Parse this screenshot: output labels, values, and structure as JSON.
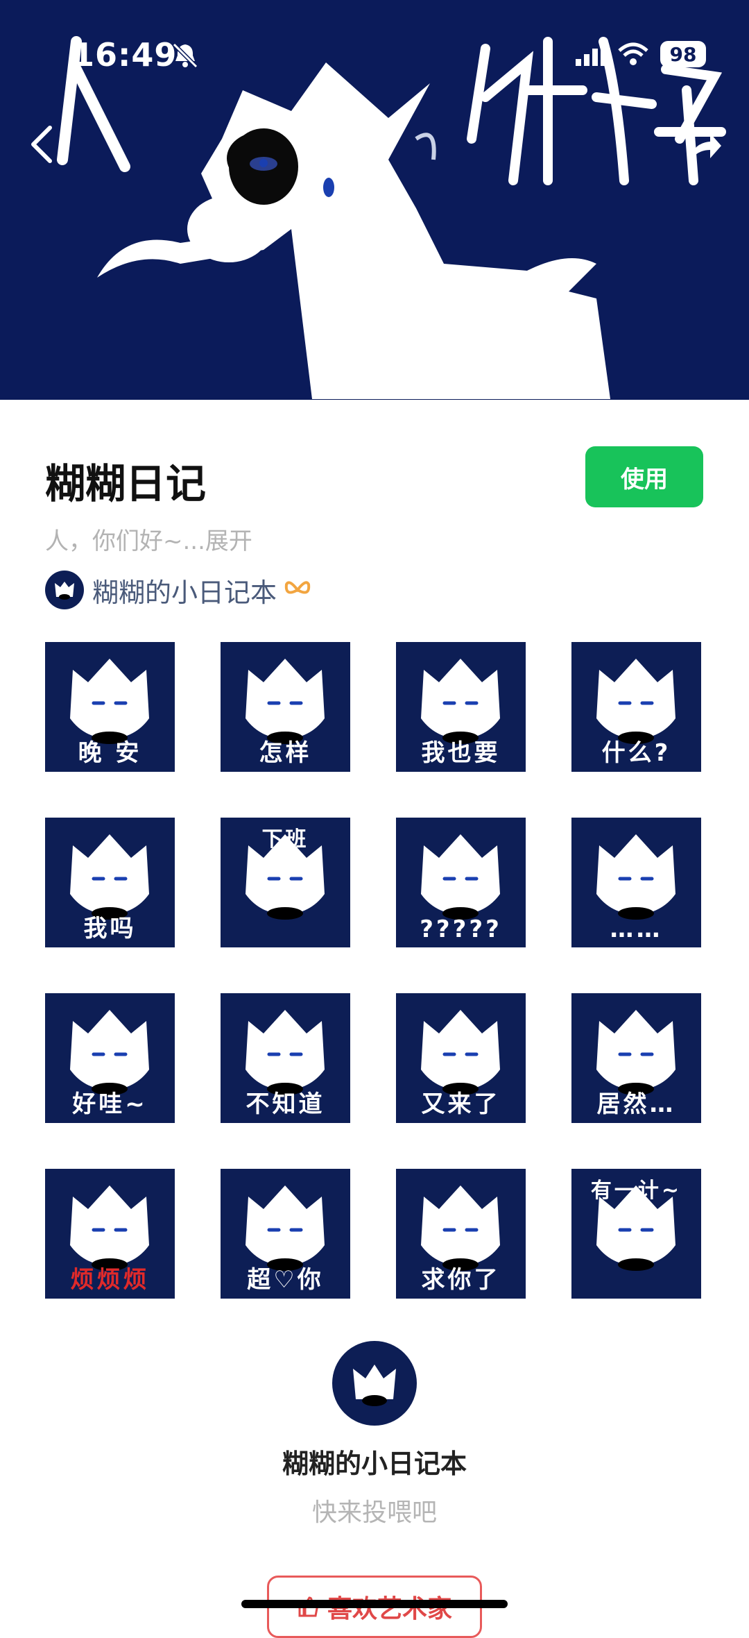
{
  "status_bar": {
    "time": "16:49",
    "battery": "98"
  },
  "banner": {
    "text": "人 你好"
  },
  "pack": {
    "title": "糊糊日记",
    "use_label": "使用",
    "description": "人，你们好~...展开",
    "author": "糊糊的小日记本"
  },
  "stickers": [
    {
      "caption": "晚 安"
    },
    {
      "caption": "怎样"
    },
    {
      "caption": "我也要"
    },
    {
      "caption": "什么?"
    },
    {
      "caption": "我吗"
    },
    {
      "caption": ""
    },
    {
      "caption": "?????"
    },
    {
      "caption": "……"
    },
    {
      "caption": "好哇~"
    },
    {
      "caption": "不知道"
    },
    {
      "caption": "又来了"
    },
    {
      "caption": "居然…"
    },
    {
      "caption": "烦烦烦"
    },
    {
      "caption": "超♡你"
    },
    {
      "caption": "求你了"
    },
    {
      "caption": ""
    }
  ],
  "sticker_extra": {
    "s6_top": "下班",
    "s16_top": "有一计~"
  },
  "artist": {
    "name": "糊糊的小日记本",
    "subtitle": "快来投喂吧",
    "like_label": "喜欢艺术家"
  },
  "colors": {
    "banner_bg": "#0b1b5a",
    "sticker_bg": "#0d1e55",
    "accent_green": "#18c35a",
    "like_red": "#e04848"
  }
}
